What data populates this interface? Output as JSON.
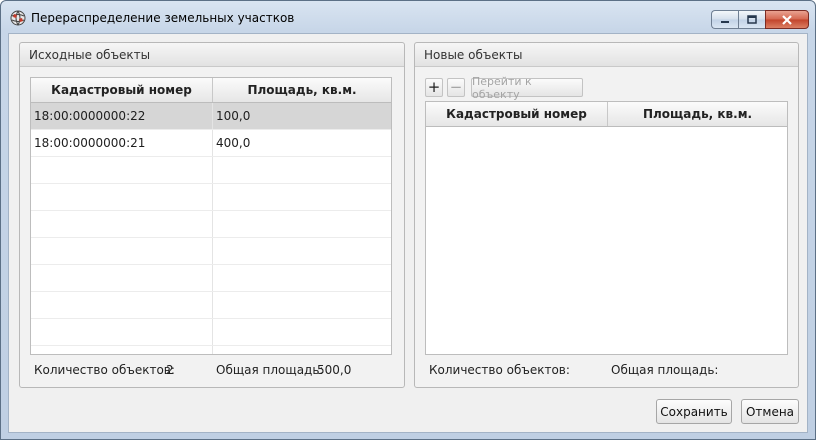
{
  "window": {
    "title": "Перераспределение земельных участков"
  },
  "source_panel": {
    "header": "Исходные объекты",
    "columns": [
      "Кадастровый номер",
      "Площадь, кв.м."
    ],
    "rows": [
      {
        "cadastral": "18:00:0000000:22",
        "area": "100,0"
      },
      {
        "cadastral": "18:00:0000000:21",
        "area": "400,0"
      }
    ],
    "count_label": "Количество объектов:",
    "count_value": "2",
    "area_label": "Общая площадь:",
    "area_value": "500,0"
  },
  "new_panel": {
    "header": "Новые объекты",
    "toolbar": {
      "add_label": "+",
      "remove_label": "−",
      "goto_label": "Перейти к объекту"
    },
    "columns": [
      "Кадастровый номер",
      "Площадь, кв.м."
    ],
    "count_label": "Количество объектов:",
    "area_label": "Общая площадь:"
  },
  "buttons": {
    "save": "Сохранить",
    "cancel": "Отмена"
  },
  "icons": {
    "app": "globe-icon",
    "minimize": "minimize-icon",
    "maximize": "maximize-icon",
    "close": "close-icon"
  }
}
